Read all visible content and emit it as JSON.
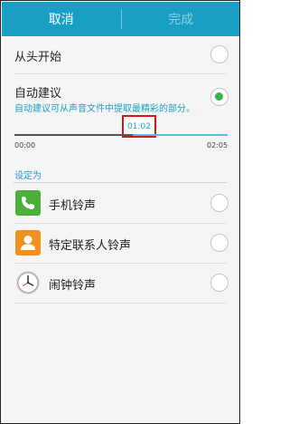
{
  "topbar": {
    "cancel_label": "取消",
    "done_label": "完成"
  },
  "options": {
    "from_start_label": "从头开始",
    "auto_suggest_label": "自动建议",
    "auto_suggest_desc": "自动建议可从声音文件中提取最精彩的部分。"
  },
  "slider": {
    "current_time": "01:02",
    "start_time": "00:00",
    "end_time": "02:05"
  },
  "set_as": {
    "header": "设定为",
    "items": [
      {
        "label": "手机铃声",
        "icon": "phone-icon"
      },
      {
        "label": "特定联系人铃声",
        "icon": "contact-icon"
      },
      {
        "label": "闹钟铃声",
        "icon": "clock-icon"
      }
    ]
  },
  "colors": {
    "accent": "#1a9fc4",
    "selected": "#3cb34a",
    "highlight_box": "#e01414"
  }
}
